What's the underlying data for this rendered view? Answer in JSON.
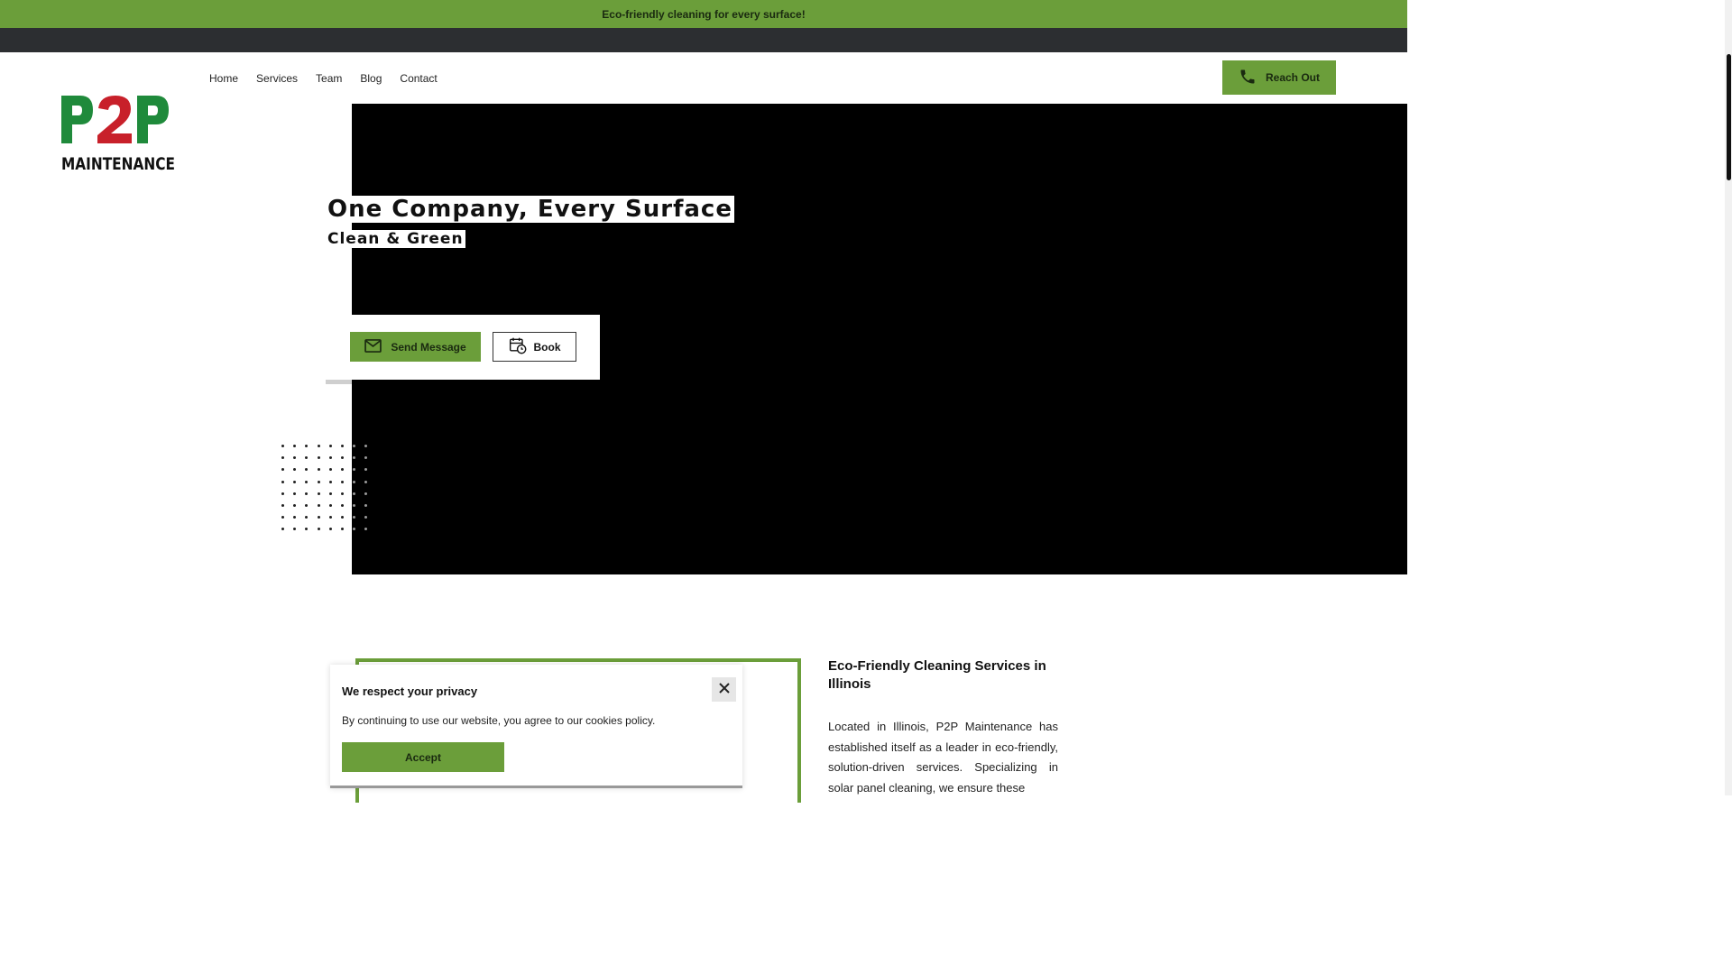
{
  "announcement": {
    "text": "Eco-friendly cleaning for every surface!"
  },
  "header": {
    "logo": {
      "top_text": "P2P",
      "bottom_text": "MAINTENANCE"
    },
    "nav": [
      {
        "label": "Home"
      },
      {
        "label": "Services"
      },
      {
        "label": "Team"
      },
      {
        "label": "Blog"
      },
      {
        "label": "Contact"
      }
    ],
    "reach_out_label": "Reach Out",
    "reach_out_icon": "phone-icon"
  },
  "hero": {
    "title": "One Company, Every Surface",
    "subtitle": "Clean & Green",
    "send_message_label": "Send Message",
    "send_message_icon": "mail-icon",
    "book_label": "Book",
    "book_icon": "calendar-clock-icon"
  },
  "about": {
    "title": "Eco-Friendly Cleaning Services in Illinois",
    "text": "Located in Illinois, P2P Maintenance has established itself as a leader in eco-friendly, solution-driven services. Specializing in solar panel cleaning, we ensure these"
  },
  "privacy": {
    "title": "We respect your privacy",
    "text": "By continuing to use our website, you agree to our cookies policy.",
    "accept_label": "Accept",
    "close_icon": "close-icon"
  },
  "colors": {
    "brand_green": "#6b9e3a",
    "logo_green": "#1f8a3b",
    "logo_red": "#c8202a",
    "dark_strip": "#2c2e31"
  }
}
